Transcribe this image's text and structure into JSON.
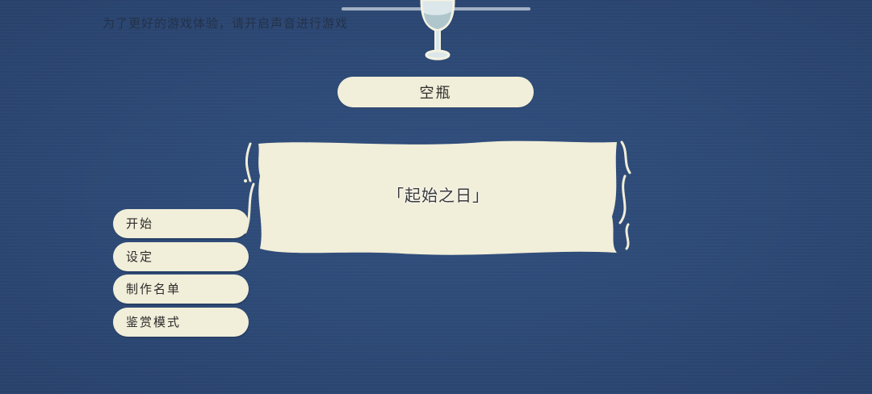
{
  "hint": {
    "sound_tip": "为了更好的游戏体验，请开启声音进行游戏"
  },
  "game": {
    "title": "空瓶",
    "chapter": "「起始之日」"
  },
  "menu": {
    "items": [
      {
        "label": "开始"
      },
      {
        "label": "设定"
      },
      {
        "label": "制作名单"
      },
      {
        "label": "鉴赏模式"
      }
    ]
  },
  "icons": {
    "logo": "wine-glass-icon"
  },
  "colors": {
    "background": "#2f4d7b",
    "panel": "#f1eed9",
    "text": "#2d2d2d"
  }
}
